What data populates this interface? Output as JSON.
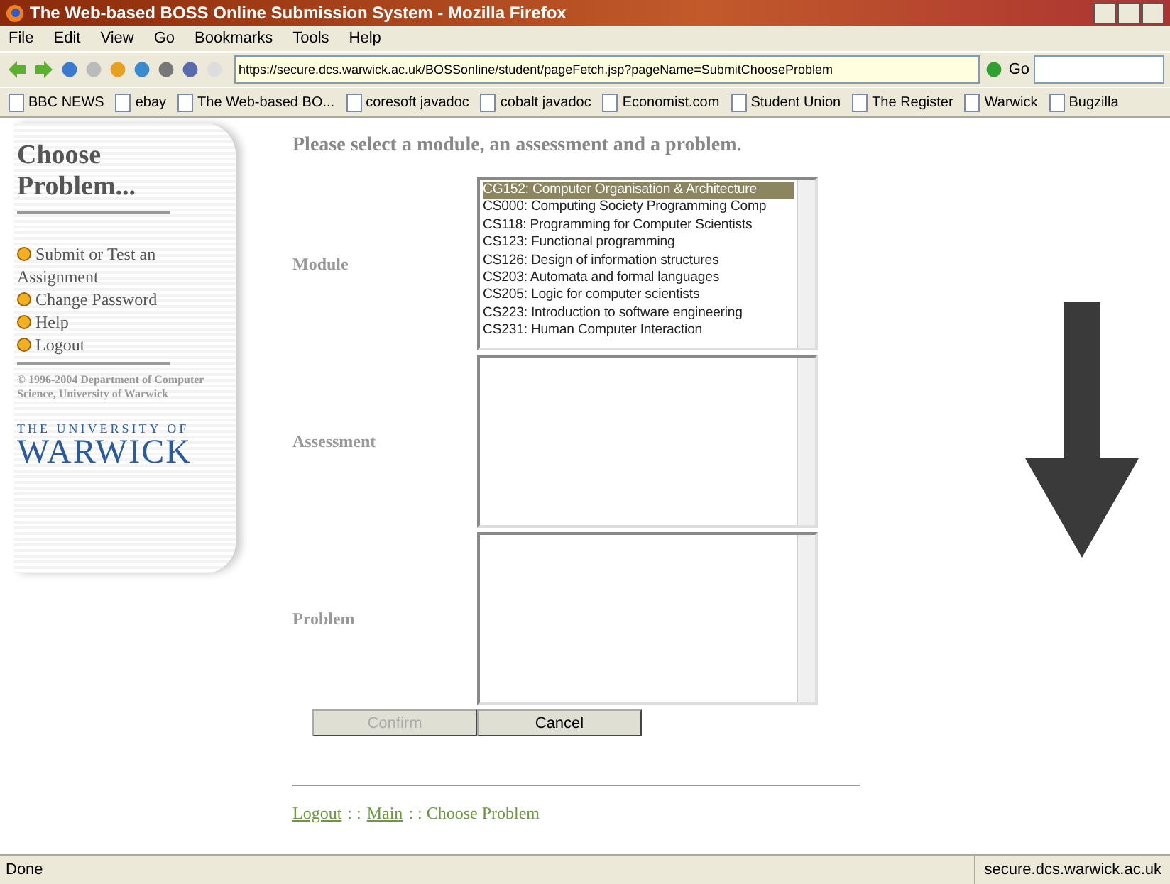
{
  "window": {
    "title": "The Web-based BOSS Online Submission System - Mozilla Firefox"
  },
  "menu": [
    "File",
    "Edit",
    "View",
    "Go",
    "Bookmarks",
    "Tools",
    "Help"
  ],
  "address": {
    "value": "https://secure.dcs.warwick.ac.uk/BOSSonline/student/pageFetch.jsp?pageName=SubmitChooseProblem"
  },
  "go_label": "Go",
  "bookmarks": [
    "BBC NEWS",
    "ebay",
    "The Web-based BO...",
    "coresoft javadoc",
    "cobalt javadoc",
    "Economist.com",
    "Student Union",
    "The Register",
    "Warwick",
    "Bugzilla"
  ],
  "sidebar": {
    "heading": "Choose Problem...",
    "links": [
      "Submit or Test an Assignment",
      "Change Password",
      "Help",
      "Logout"
    ],
    "copyright": "© 1996-2004 Department of Computer Science, University of Warwick",
    "logo_top": "THE UNIVERSITY OF",
    "logo_main": "WARWICK"
  },
  "heading": "Please select a module, an assessment and a problem.",
  "fields": [
    {
      "label": "Module",
      "options": [
        {
          "text": "CG152: Computer Organisation & Architecture",
          "selected": true
        },
        {
          "text": "CS000: Computing Society Programming Comp",
          "selected": false
        },
        {
          "text": "CS118: Programming for Computer Scientists",
          "selected": false
        },
        {
          "text": "CS123: Functional programming",
          "selected": false
        },
        {
          "text": "CS126: Design of information structures",
          "selected": false
        },
        {
          "text": "CS203: Automata and formal languages",
          "selected": false
        },
        {
          "text": "CS205: Logic for computer scientists",
          "selected": false
        },
        {
          "text": "CS223: Introduction to software engineering",
          "selected": false
        },
        {
          "text": "CS231: Human Computer Interaction",
          "selected": false
        }
      ]
    },
    {
      "label": "Assessment"
    },
    {
      "label": "Problem"
    }
  ],
  "buttons": [
    {
      "label": "Confirm",
      "disabled": true
    },
    {
      "label": "Cancel",
      "disabled": false
    }
  ],
  "breadcrumb": [
    {
      "kind": "link",
      "text": "Logout"
    },
    {
      "kind": "text",
      "text": ": :"
    },
    {
      "kind": "link",
      "text": "Main"
    },
    {
      "kind": "text",
      "text": ": : Choose Problem"
    }
  ],
  "status_bar": {
    "text": "Done",
    "host": "secure.dcs.warwick.ac.uk"
  }
}
